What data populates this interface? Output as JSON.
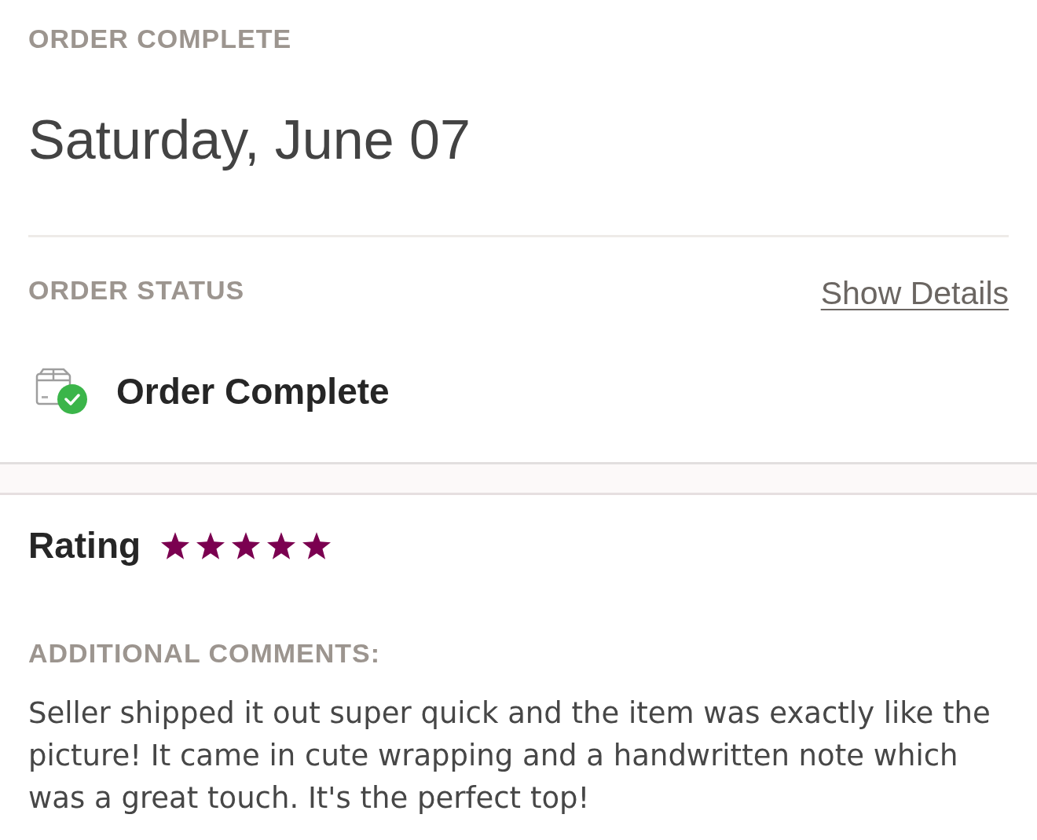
{
  "header": {
    "label": "ORDER COMPLETE",
    "date": "Saturday, June 07"
  },
  "order_status": {
    "label": "ORDER STATUS",
    "link": "Show Details",
    "status": "Order Complete"
  },
  "rating": {
    "label": "Rating",
    "stars": 5
  },
  "comments": {
    "label": "ADDITIONAL COMMENTS:",
    "text": "Seller shipped it out super quick and the item was exactly like the picture! It came in cute wrapping and a handwritten note which was a great touch. It's the perfect top!"
  }
}
